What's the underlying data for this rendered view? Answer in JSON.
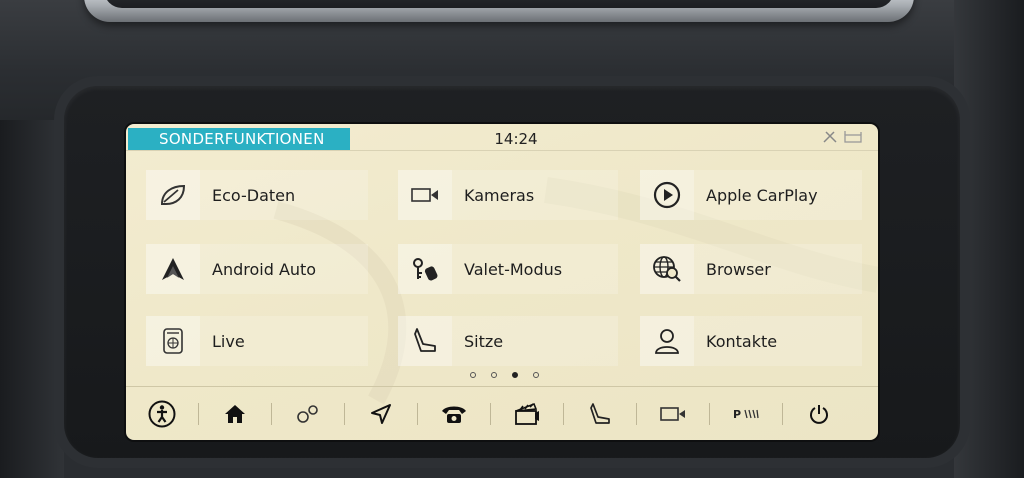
{
  "status_bar": {
    "section_title": "SONDERFUNKTIONEN",
    "time": "14:24",
    "accent_color": "#2bb0c3"
  },
  "tiles": [
    {
      "label": "Eco-Daten",
      "icon": "leaf-icon"
    },
    {
      "label": "Kameras",
      "icon": "camera-icon"
    },
    {
      "label": "Apple CarPlay",
      "icon": "play-circle-icon"
    },
    {
      "label": "Android Auto",
      "icon": "android-auto-icon"
    },
    {
      "label": "Valet-Modus",
      "icon": "valet-keys-icon"
    },
    {
      "label": "Browser",
      "icon": "globe-search-icon"
    },
    {
      "label": "Live",
      "icon": "live-globe-icon"
    },
    {
      "label": "Sitze",
      "icon": "seat-icon"
    },
    {
      "label": "Kontakte",
      "icon": "contact-person-icon"
    }
  ],
  "page_indicator": {
    "count": 4,
    "active": 3
  },
  "bottom_bar": [
    {
      "icon": "accessibility-icon"
    },
    {
      "icon": "home-icon"
    },
    {
      "icon": "settings-circles-icon"
    },
    {
      "icon": "navigation-arrow-icon"
    },
    {
      "icon": "phone-icon"
    },
    {
      "icon": "media-clapper-icon"
    },
    {
      "icon": "seat-icon"
    },
    {
      "icon": "camera-icon"
    },
    {
      "icon": "parking-sensor-icon",
      "label": "P"
    },
    {
      "icon": "power-icon"
    }
  ]
}
